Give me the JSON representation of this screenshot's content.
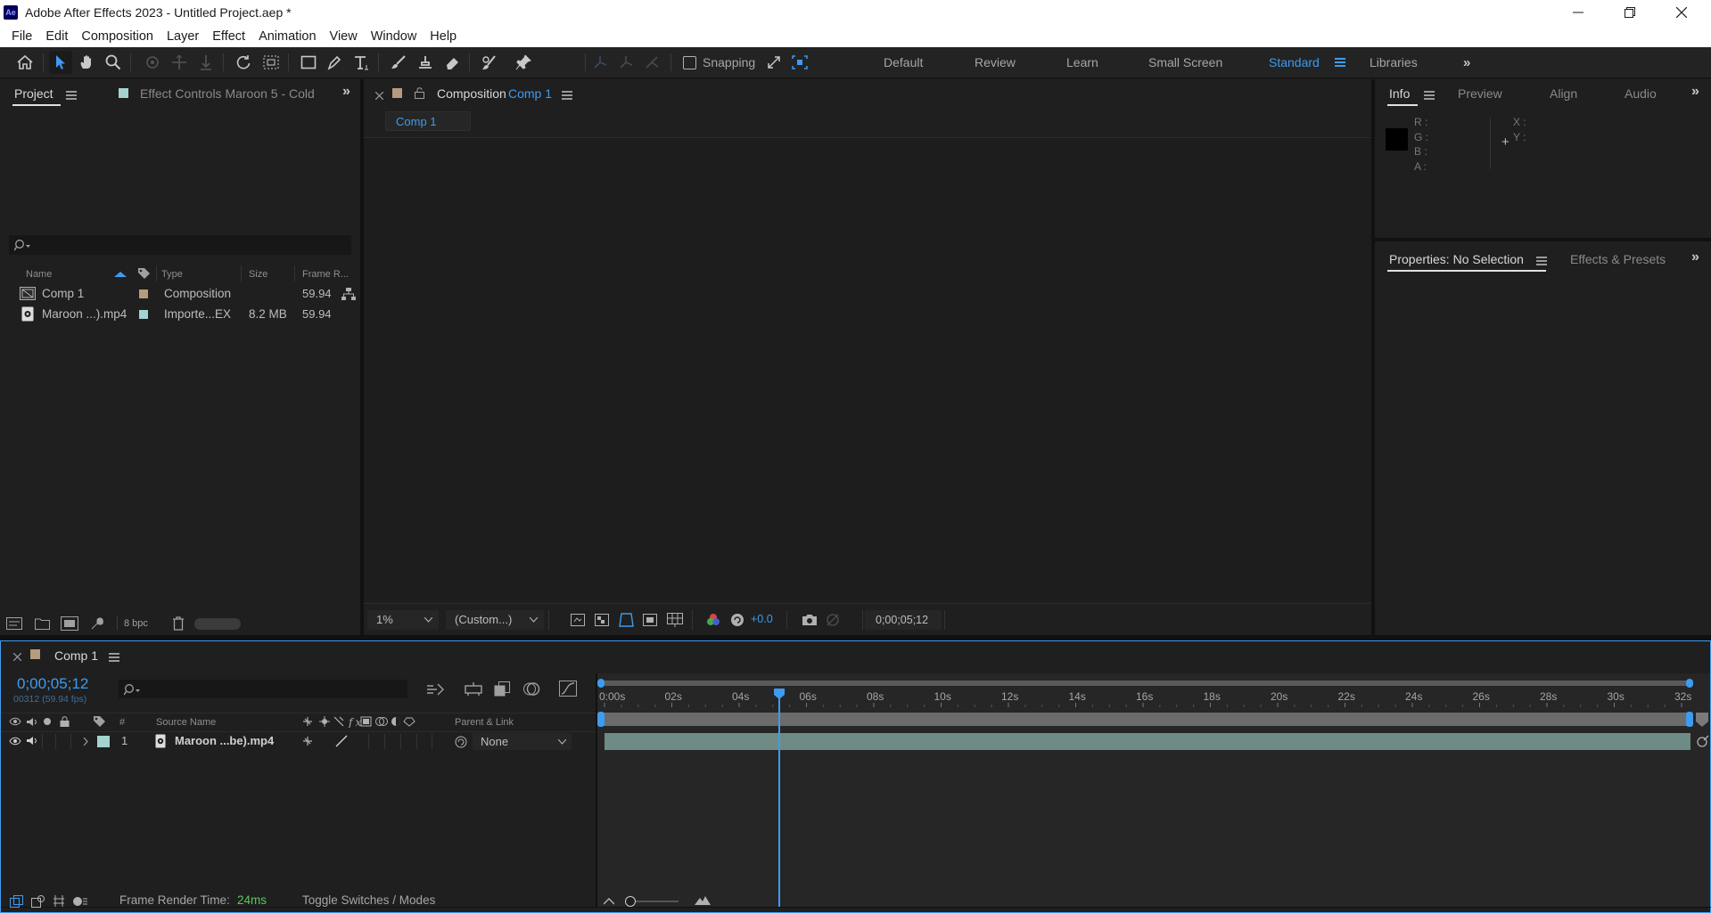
{
  "window": {
    "app_badge": "Ae",
    "title": "Adobe After Effects 2023 - Untitled Project.aep *"
  },
  "menu": [
    "File",
    "Edit",
    "Composition",
    "Layer",
    "Effect",
    "Animation",
    "View",
    "Window",
    "Help"
  ],
  "toolbar": {
    "snapping_label": "Snapping",
    "workspaces": [
      "Default",
      "Review",
      "Learn",
      "Small Screen",
      "Standard",
      "Libraries"
    ],
    "active_workspace": "Standard"
  },
  "project_panel": {
    "tab_project": "Project",
    "tab_effect_controls": "Effect Controls Maroon 5 - Cold",
    "columns": {
      "name": "Name",
      "type": "Type",
      "size": "Size",
      "frame_rate": "Frame R..."
    },
    "items": [
      {
        "name": "Comp 1",
        "type": "Composition",
        "size": "",
        "frame_rate": "59.94",
        "label_color": "#b59c7d"
      },
      {
        "name": "Maroon ...).mp4",
        "type": "Importe...EX",
        "size": "8.2 MB",
        "frame_rate": "59.94",
        "label_color": "#a4d3d0"
      }
    ],
    "bpc": "8 bpc"
  },
  "composition_panel": {
    "tab_prefix": "Composition",
    "tab_comp": "Comp 1",
    "breadcrumb": "Comp 1",
    "zoom": "1%",
    "resolution": "(Custom...)",
    "exposure": "+0.0",
    "timecode": "0;00;05;12"
  },
  "info_panel": {
    "tabs": [
      "Info",
      "Preview",
      "Align",
      "Audio"
    ],
    "rgba_labels": [
      "R :",
      "G :",
      "B :",
      "A :"
    ],
    "xy_labels": [
      "X :",
      "Y :"
    ]
  },
  "properties_panel": {
    "tab_properties": "Properties: No Selection",
    "tab_effects": "Effects & Presets"
  },
  "timeline": {
    "tab": "Comp 1",
    "timecode": "0;00;05;12",
    "frame_info": "00312 (59.94 fps)",
    "columns": {
      "number": "#",
      "source_name": "Source Name",
      "parent": "Parent & Link"
    },
    "layers": [
      {
        "number": "1",
        "name": "Maroon ...be).mp4",
        "parent": "None",
        "label_color": "#a4d3d0"
      }
    ],
    "ruler_labels": [
      "0:00s",
      "02s",
      "04s",
      "06s",
      "08s",
      "10s",
      "12s",
      "14s",
      "16s",
      "18s",
      "20s",
      "22s",
      "24s",
      "26s",
      "28s",
      "30s",
      "32s"
    ],
    "playhead_seconds": 5.2,
    "footer": {
      "render_time_label": "Frame Render Time:",
      "render_time_value": "24ms",
      "toggle_label": "Toggle Switches / Modes"
    }
  },
  "colors": {
    "accent_blue": "#3d9bf0",
    "panel_bg": "#1f1f1f",
    "layer_bar": "#6f8b86"
  }
}
